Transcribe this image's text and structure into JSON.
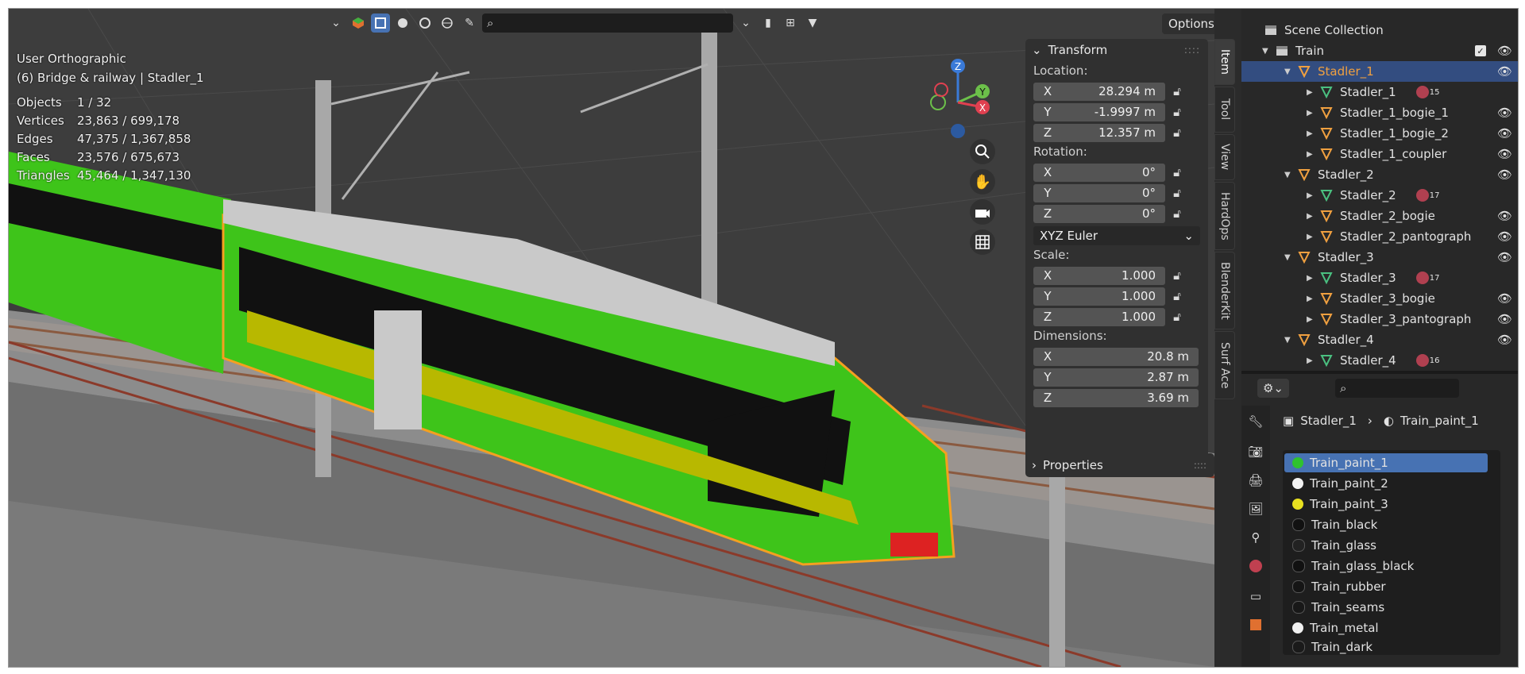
{
  "viewport": {
    "view_name": "User Orthographic",
    "scene_info": "(6) Bridge & railway | Stadler_1",
    "stats": [
      {
        "label": "Objects",
        "value": "1 / 32"
      },
      {
        "label": "Vertices",
        "value": "23,863 / 699,178"
      },
      {
        "label": "Edges",
        "value": "47,375 / 1,367,858"
      },
      {
        "label": "Faces",
        "value": "23,576 / 675,673"
      },
      {
        "label": "Triangles",
        "value": "45,464 / 1,347,130"
      }
    ],
    "options_label": "Options",
    "colors": {
      "train_green": "#3ec41a",
      "train_yellow": "#b8b800",
      "selection_outline": "#f5a020",
      "bridge": "#7a7a7a",
      "rail_fence": "#8b3a2a"
    }
  },
  "gizmo": {
    "x": "X",
    "y": "Y",
    "z": "Z"
  },
  "npanel": {
    "transform_title": "Transform",
    "location_label": "Location:",
    "location": [
      {
        "axis": "X",
        "value": "28.294 m"
      },
      {
        "axis": "Y",
        "value": "-1.9997 m"
      },
      {
        "axis": "Z",
        "value": "12.357 m"
      }
    ],
    "rotation_label": "Rotation:",
    "rotation": [
      {
        "axis": "X",
        "value": "0°"
      },
      {
        "axis": "Y",
        "value": "0°"
      },
      {
        "axis": "Z",
        "value": "0°"
      }
    ],
    "rotation_mode": "XYZ Euler",
    "scale_label": "Scale:",
    "scale": [
      {
        "axis": "X",
        "value": "1.000"
      },
      {
        "axis": "Y",
        "value": "1.000"
      },
      {
        "axis": "Z",
        "value": "1.000"
      }
    ],
    "dimensions_label": "Dimensions:",
    "dimensions": [
      {
        "axis": "X",
        "value": "20.8 m"
      },
      {
        "axis": "Y",
        "value": "2.87 m"
      },
      {
        "axis": "Z",
        "value": "3.69 m"
      }
    ],
    "properties_title": "Properties"
  },
  "vtabs": [
    "Item",
    "Tool",
    "View",
    "HardOps",
    "BlenderKit",
    "Surf Ace"
  ],
  "outliner": {
    "rows": [
      {
        "label": "Scene Collection",
        "kind": "scene"
      },
      {
        "label": "Train",
        "kind": "collection"
      },
      {
        "label": "Stadler_1",
        "kind": "object"
      },
      {
        "label": "Stadler_1",
        "kind": "mesh",
        "badge": "15"
      },
      {
        "label": "Stadler_1_bogie_1",
        "kind": "object"
      },
      {
        "label": "Stadler_1_bogie_2",
        "kind": "object"
      },
      {
        "label": "Stadler_1_coupler",
        "kind": "object"
      },
      {
        "label": "Stadler_2",
        "kind": "object"
      },
      {
        "label": "Stadler_2",
        "kind": "mesh",
        "badge": "17"
      },
      {
        "label": "Stadler_2_bogie",
        "kind": "object"
      },
      {
        "label": "Stadler_2_pantograph",
        "kind": "object"
      },
      {
        "label": "Stadler_3",
        "kind": "object"
      },
      {
        "label": "Stadler_3",
        "kind": "mesh",
        "badge": "17"
      },
      {
        "label": "Stadler_3_bogie",
        "kind": "object"
      },
      {
        "label": "Stadler_3_pantograph",
        "kind": "object"
      },
      {
        "label": "Stadler_4",
        "kind": "object"
      },
      {
        "label": "Stadler_4",
        "kind": "mesh",
        "badge": "16"
      }
    ]
  },
  "properties": {
    "breadcrumb_object": "Stadler_1",
    "breadcrumb_material": "Train_paint_1",
    "materials": [
      {
        "name": "Train_paint_1",
        "color": "#2fc22f"
      },
      {
        "name": "Train_paint_2",
        "color": "#f2f2f2"
      },
      {
        "name": "Train_paint_3",
        "color": "#e8e020"
      },
      {
        "name": "Train_black",
        "color": "#111111"
      },
      {
        "name": "Train_glass",
        "color": "#222222"
      },
      {
        "name": "Train_glass_black",
        "color": "#111111"
      },
      {
        "name": "Train_rubber",
        "color": "#151515"
      },
      {
        "name": "Train_seams",
        "color": "#181818"
      },
      {
        "name": "Train_metal",
        "color": "#f0f0f0"
      },
      {
        "name": "Train_dark",
        "color": "#1a1a1a"
      }
    ]
  }
}
